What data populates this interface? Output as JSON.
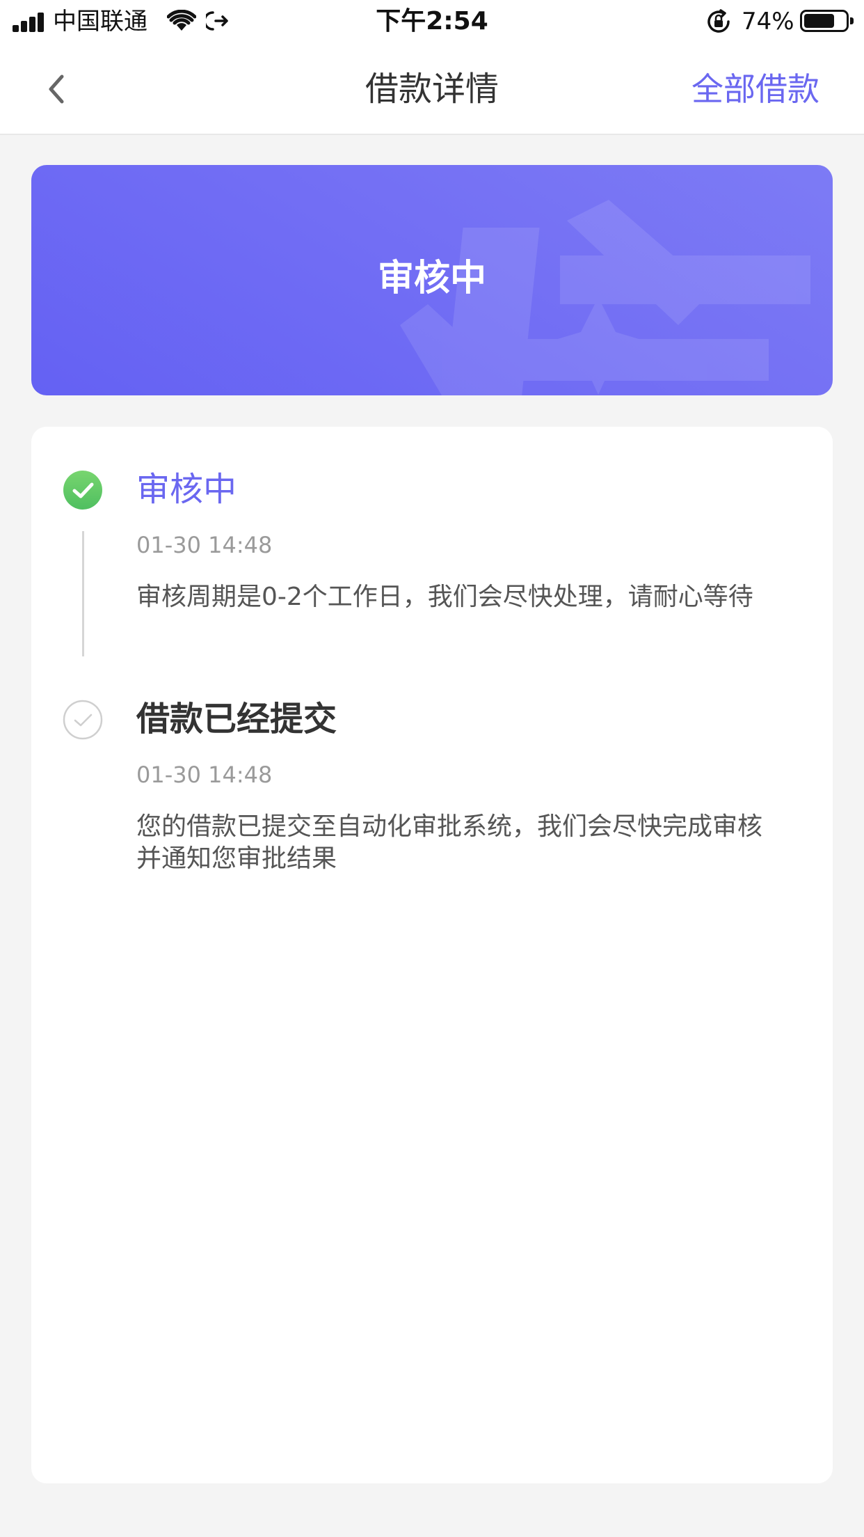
{
  "status_bar": {
    "carrier": "中国联通",
    "time": "下午2:54",
    "battery_percent": "74%",
    "battery_level": 0.74,
    "icons": [
      "signal-icon",
      "wifi-icon",
      "link-arrow-icon",
      "orientation-lock-icon",
      "battery-icon"
    ]
  },
  "nav": {
    "title": "借款详情",
    "action_label": "全部借款",
    "back_icon": "chevron-left-icon"
  },
  "banner": {
    "status": "审核中",
    "accent_color": "#6a67f0"
  },
  "timeline": {
    "steps": [
      {
        "title": "审核中",
        "time": "01-30 14:48",
        "description": "审核周期是0-2个工作日，我们会尽快处理，请耐心等待",
        "state": "current",
        "icon": "check-circle-filled-icon",
        "icon_color": "#63c96b"
      },
      {
        "title": "借款已经提交",
        "time": "01-30 14:48",
        "description": "您的借款已提交至自动化审批系统，我们会尽快完成审核并通知您审批结果",
        "state": "done",
        "icon": "check-circle-outline-icon",
        "icon_color": "#cccccc"
      }
    ]
  }
}
